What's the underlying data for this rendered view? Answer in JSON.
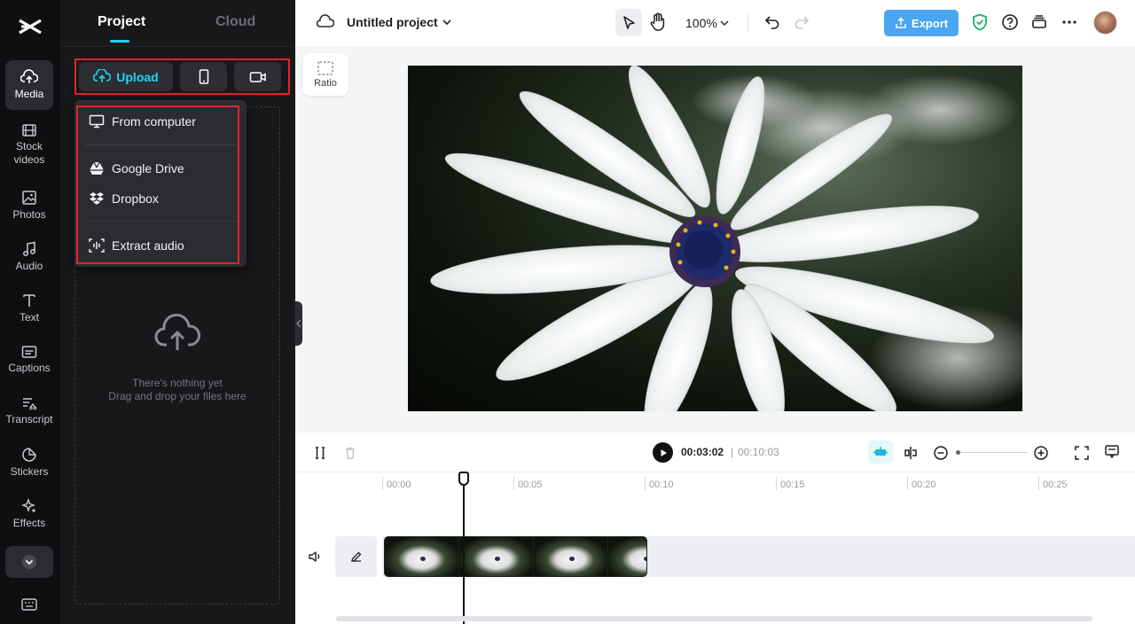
{
  "rail": {
    "items": [
      {
        "label": "Media"
      },
      {
        "label": "Stock\nvideos"
      },
      {
        "label": "Photos"
      },
      {
        "label": "Audio"
      },
      {
        "label": "Text"
      },
      {
        "label": "Captions"
      },
      {
        "label": "Transcript"
      },
      {
        "label": "Stickers"
      },
      {
        "label": "Effects"
      }
    ]
  },
  "panel": {
    "tab_project": "Project",
    "tab_cloud": "Cloud",
    "upload_label": "Upload",
    "dropdown": {
      "from_computer": "From computer",
      "google_drive": "Google Drive",
      "dropbox": "Dropbox",
      "extract_audio": "Extract audio"
    },
    "empty_line1": "There's nothing yet",
    "empty_line2": "Drag and drop your files here"
  },
  "topbar": {
    "project_title": "Untitled project",
    "zoom": "100%",
    "export_label": "Export"
  },
  "canvas": {
    "ratio_label": "Ratio"
  },
  "timeline": {
    "current_time": "00:03:02",
    "separator": "|",
    "total_time": "00:10:03",
    "ticks": [
      "00:00",
      "00:05",
      "00:10",
      "00:15",
      "00:20",
      "00:25"
    ]
  },
  "colors": {
    "accent": "#1fd5f0",
    "export": "#4aa6f0",
    "highlight_outline": "#e0242a"
  }
}
